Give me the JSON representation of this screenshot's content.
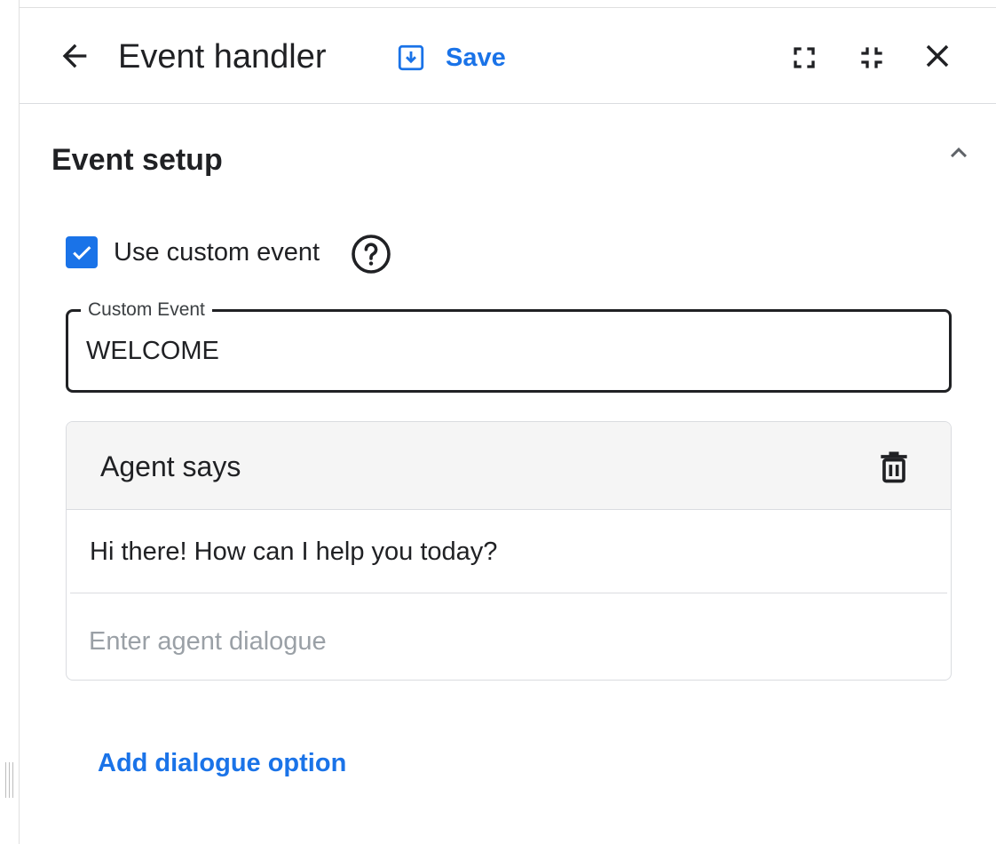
{
  "header": {
    "title": "Event handler",
    "save_label": "Save",
    "icons": {
      "back": "arrow-back-icon",
      "save": "save-download-icon",
      "fullscreen": "fullscreen-icon",
      "exit_fullscreen": "fullscreen-exit-icon",
      "close": "close-icon"
    }
  },
  "event_setup": {
    "title": "Event setup",
    "collapse_icon": "chevron-up-icon",
    "use_custom_event": {
      "label": "Use custom event",
      "checked": true,
      "help_icon": "help-icon"
    },
    "custom_event_field": {
      "label": "Custom Event",
      "value": "WELCOME"
    }
  },
  "agent_says": {
    "title": "Agent says",
    "delete_icon": "delete-icon",
    "dialogues": [
      "Hi there! How can I help you today?"
    ],
    "input_placeholder": "Enter agent dialogue",
    "add_option_label": "Add dialogue option"
  },
  "colors": {
    "accent": "#1a73e8",
    "text": "#202124",
    "placeholder": "#9aa0a6",
    "border": "#dadce0",
    "card_header_bg": "#f5f5f5"
  }
}
